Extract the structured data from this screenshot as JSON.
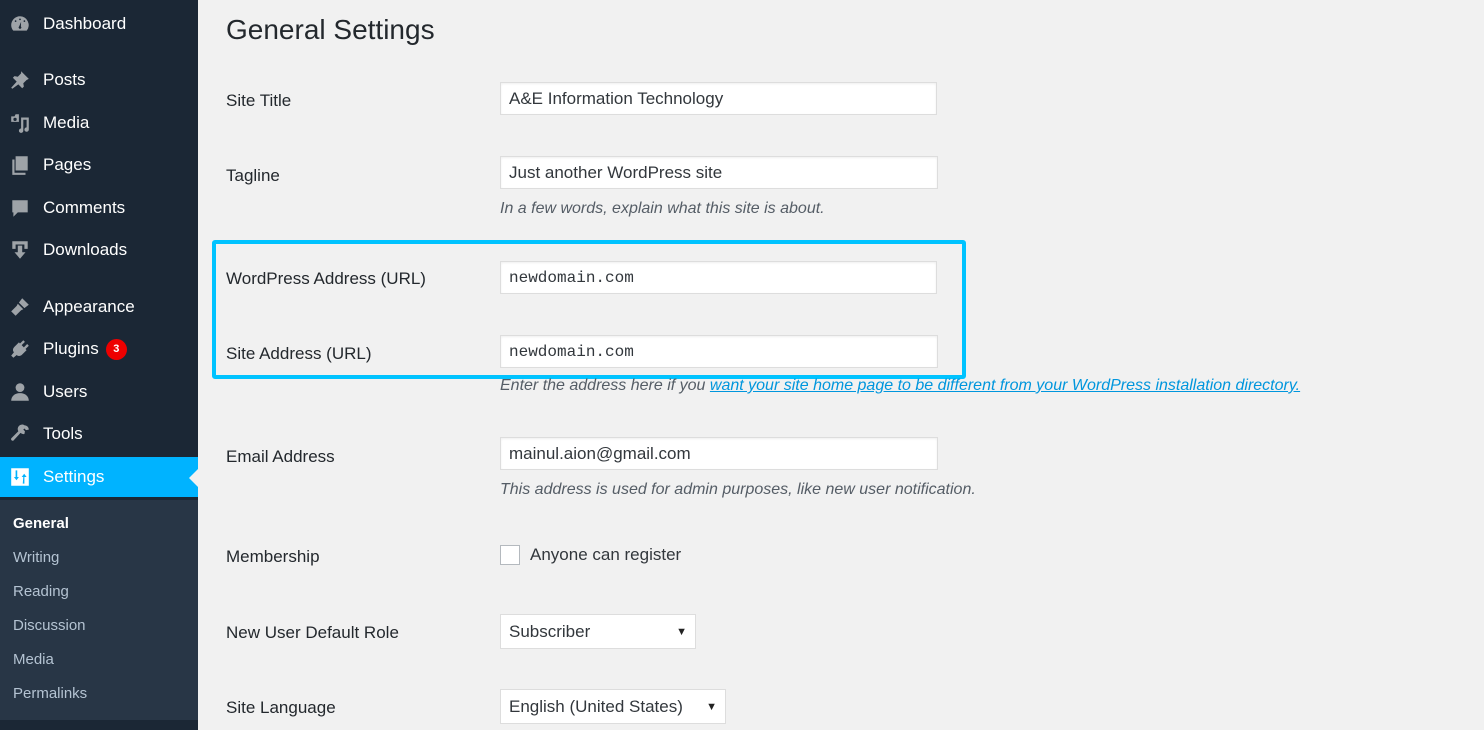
{
  "sidebar": {
    "items": [
      {
        "label": "Dashboard",
        "icon": "dashboard-icon"
      },
      {
        "label": "Posts",
        "icon": "pin-icon"
      },
      {
        "label": "Media",
        "icon": "media-icon"
      },
      {
        "label": "Pages",
        "icon": "pages-icon"
      },
      {
        "label": "Comments",
        "icon": "comment-icon"
      },
      {
        "label": "Downloads",
        "icon": "download-icon"
      },
      {
        "label": "Appearance",
        "icon": "brush-icon"
      },
      {
        "label": "Plugins",
        "icon": "plug-icon",
        "badge": "3"
      },
      {
        "label": "Users",
        "icon": "user-icon"
      },
      {
        "label": "Tools",
        "icon": "wrench-icon"
      },
      {
        "label": "Settings",
        "icon": "settings-icon",
        "active": true
      }
    ],
    "submenu": [
      "General",
      "Writing",
      "Reading",
      "Discussion",
      "Media",
      "Permalinks"
    ],
    "current_submenu": "General",
    "accent_color": "#00b3ff"
  },
  "page": {
    "title": "General Settings",
    "site_title": {
      "label": "Site Title",
      "value": "A&E Information Technology"
    },
    "tagline": {
      "label": "Tagline",
      "value": "Just another WordPress site",
      "description": "In a few words, explain what this site is about."
    },
    "wp_address": {
      "label": "WordPress Address (URL)",
      "value": "newdomain.com"
    },
    "site_address": {
      "label": "Site Address (URL)",
      "value": "newdomain.com",
      "description_prefix": "Enter the address here if you ",
      "description_link": "want your site home page to be different from your WordPress installation directory."
    },
    "email": {
      "label": "Email Address",
      "value": "mainul.aion@gmail.com",
      "description": "This address is used for admin purposes, like new user notification."
    },
    "membership": {
      "label": "Membership",
      "checkbox_label": "Anyone can register",
      "checked": false
    },
    "default_role": {
      "label": "New User Default Role",
      "selected": "Subscriber"
    },
    "language": {
      "label": "Site Language",
      "selected": "English (United States)"
    },
    "highlight_color": "#00c3ff"
  }
}
